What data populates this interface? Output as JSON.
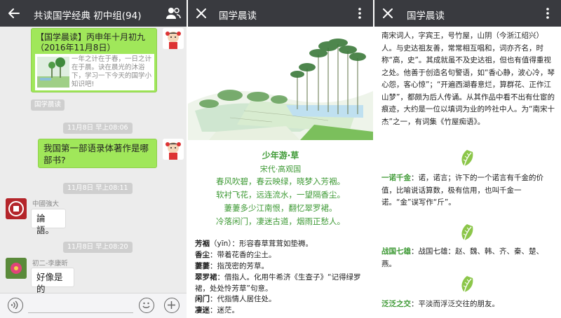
{
  "chat": {
    "title": "共读国学经典 初中组(94)",
    "article": {
      "title": "【国学晨读】丙申年十月初九（2016年11月8日）",
      "desc": "一年之计在于春，一日之计在于晨。诀在晨光的沐浴下，学习一下今天的国学小知识吧!"
    },
    "tag": "国学晨读",
    "time1": "11月8日 早上08:06",
    "msg_question": "我国第一部语录体著作是哪部书?",
    "time2": "11月8日 早上08:11",
    "sender1": "中國強大",
    "msg_answer1": "論語。",
    "time3": "11月8日 早上08:20",
    "sender2": "初二-李康昕",
    "msg_answer2": "好像是的"
  },
  "article": {
    "title": "国学晨读",
    "poem_title": "少年游·草",
    "poem_author": "宋代·高观国",
    "poem_lines": [
      "春风吹碧，春云映绿，晓梦入芳裀。",
      "软衬飞花，远连流水，一望隔香尘。",
      "萋萋多少江南恨，翻忆翠罗裙。",
      "冷落闲门，凄迷古道，烟雨正愁人。"
    ],
    "glossary": [
      {
        "term": "芳裀",
        "def": "（yīn）：形容春草茸茸如垫褥。"
      },
      {
        "term": "香尘",
        "def": "：带着花香的尘土。"
      },
      {
        "term": "萋萋",
        "def": "：指茂密的芳草。"
      },
      {
        "term": "翠罗裙",
        "def": "：借指人。化用牛希济《生查子》“记得绿罗裙，处处怜芳草”句意。"
      },
      {
        "term": "闲门",
        "def": "：代指情人居住处。"
      },
      {
        "term": "凄迷",
        "def": "：迷茫。"
      }
    ]
  },
  "notes": {
    "title": "国学晨读",
    "bio": "南宋词人，字宾王，号竹屋，山阴（今浙江绍兴）人。与史达祖友善，常常相互唱和，词亦齐名，时称“高，史”。其成就虽不及史达祖，但也有值得重视之处。他善于创造名句警语，如“香心静，波心冷，琴心怨，客心惊”；“开遍西湖春意烂，算群花、正作江山梦”，都颇为后人传诵。从其作品中看不出有仕宦的痕迹，大约是一位以填词为业的吟社中人。为“南宋十杰”之一，有词集《竹屋痴语》。",
    "entries": [
      {
        "term": "一诺千金",
        "def": "：诺，诺言；许下的一个诺言有千金的价值，比喻说话算数，极有信用，也叫千金一诺。“金”误写作“斤”。"
      },
      {
        "term": "战国七雄",
        "def": "：战国七雄：赵、魏、韩、齐、秦、楚、燕。"
      },
      {
        "term": "泛泛之交",
        "def": "：平淡而浮泛交往的朋友。"
      }
    ]
  }
}
